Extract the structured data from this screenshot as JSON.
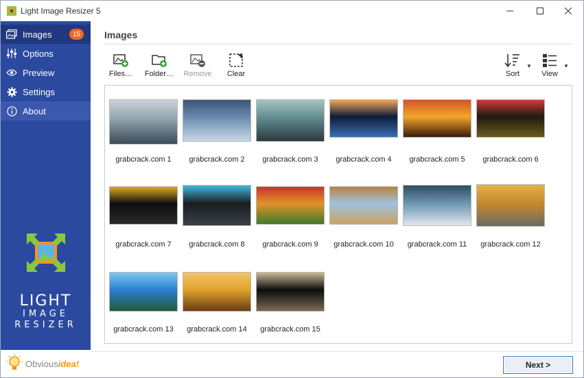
{
  "window": {
    "title": "Light Image Resizer 5",
    "controls": {
      "minimize": "–",
      "maximize": "☐",
      "close": "✕"
    }
  },
  "sidebar": {
    "items": [
      {
        "label": "Images",
        "icon": "images-icon",
        "badge": "15",
        "active": true
      },
      {
        "label": "Options",
        "icon": "sliders-icon"
      },
      {
        "label": "Preview",
        "icon": "eye-icon"
      },
      {
        "label": "Settings",
        "icon": "gear-icon"
      },
      {
        "label": "About",
        "icon": "info-icon"
      }
    ],
    "logo": {
      "line1": "LIGHT",
      "line2": "IMAGE",
      "line3": "RESIZER"
    },
    "brand": {
      "prefix": "Obvious",
      "suffix": "idea!"
    }
  },
  "content": {
    "title": "Images",
    "toolbar": {
      "files": "Files…",
      "folder": "Folder…",
      "remove": "Remove",
      "clear": "Clear",
      "sort": "Sort",
      "view": "View"
    },
    "images": [
      {
        "label": "grabcrack.com 1",
        "colors": [
          "#8fa1ad",
          "#3a4a56",
          "#c9d3da"
        ]
      },
      {
        "label": "grabcrack.com 2",
        "colors": [
          "#6f8eb3",
          "#c7d6e6",
          "#3b5478"
        ]
      },
      {
        "label": "grabcrack.com 3",
        "colors": [
          "#5f8a8f",
          "#2b3a3d",
          "#a7c2c2"
        ]
      },
      {
        "label": "grabcrack.com 4",
        "colors": [
          "#0e1d3a",
          "#3a6fb3",
          "#f2a65a"
        ]
      },
      {
        "label": "grabcrack.com 5",
        "colors": [
          "#f4a52a",
          "#3a1c0a",
          "#d0572a"
        ]
      },
      {
        "label": "grabcrack.com 6",
        "colors": [
          "#1d1a10",
          "#6b5a1f",
          "#d23a3a"
        ]
      },
      {
        "label": "grabcrack.com 7",
        "colors": [
          "#0d0d0d",
          "#2a2a2a",
          "#e0a820"
        ]
      },
      {
        "label": "grabcrack.com 8",
        "colors": [
          "#1a1c1e",
          "#3b4247",
          "#3fb8e0"
        ]
      },
      {
        "label": "grabcrack.com 9",
        "colors": [
          "#e0932a",
          "#3f7a2a",
          "#c8352a"
        ]
      },
      {
        "label": "grabcrack.com 10",
        "colors": [
          "#9fc2e0",
          "#c9a462",
          "#b8843d"
        ]
      },
      {
        "label": "grabcrack.com 11",
        "colors": [
          "#6c96b0",
          "#dfe7ee",
          "#2e4d61"
        ]
      },
      {
        "label": "grabcrack.com 12",
        "colors": [
          "#c8882e",
          "#6a6a64",
          "#e0b24a"
        ]
      },
      {
        "label": "grabcrack.com 13",
        "colors": [
          "#2a7fd0",
          "#1f5a3a",
          "#7fc6ee"
        ]
      },
      {
        "label": "grabcrack.com 14",
        "colors": [
          "#e0a22a",
          "#6a3d14",
          "#f2c46a"
        ]
      },
      {
        "label": "grabcrack.com 15",
        "colors": [
          "#0d0d0d",
          "#7a6a54",
          "#c9b896"
        ]
      }
    ],
    "next": "Next >"
  },
  "colors": {
    "sidebar": "#2b4a9f",
    "sidebar_active": "#20387f",
    "badge": "#f26522",
    "accent_border": "#3b6fc4"
  }
}
